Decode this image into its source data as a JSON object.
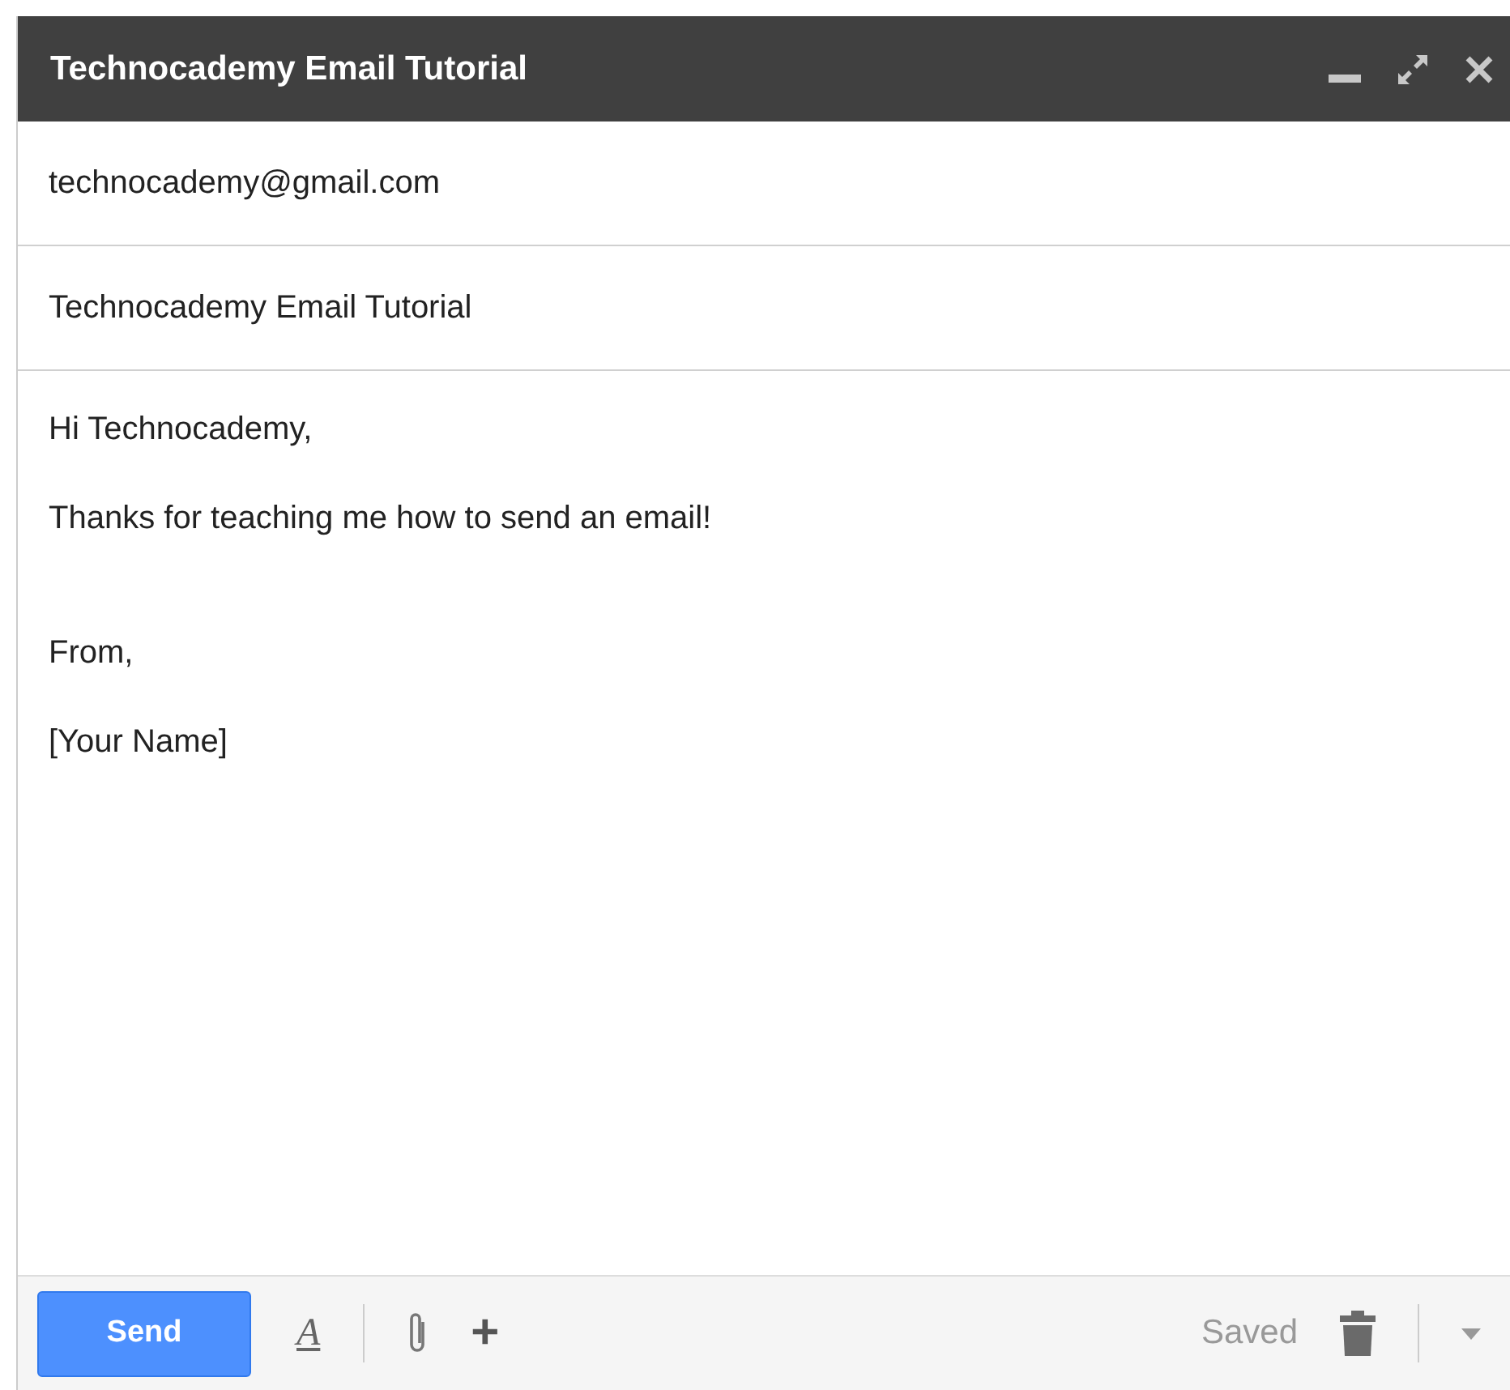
{
  "window": {
    "title": "Technocademy Email Tutorial"
  },
  "to": {
    "value": "technocademy@gmail.com"
  },
  "subject": {
    "value": "Technocademy Email Tutorial"
  },
  "body": {
    "blocks": [
      [
        "Hi Technocademy,",
        "Thanks for teaching me how to send an email!"
      ],
      [
        "From,",
        "[Your Name]"
      ]
    ]
  },
  "toolbar": {
    "send": "Send",
    "format_glyph": "A",
    "more_glyph": "+",
    "status": "Saved"
  }
}
